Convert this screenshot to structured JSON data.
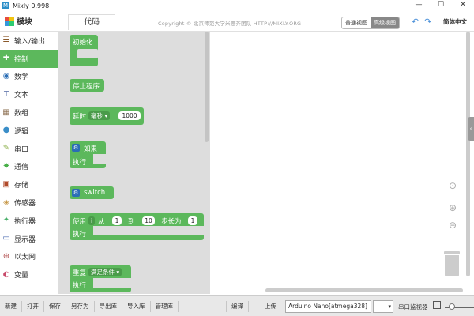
{
  "window": {
    "title": "Mixly 0.998",
    "app_icon_text": "M",
    "minimize": "—",
    "maximize": "☐",
    "close": "✕"
  },
  "header": {
    "blocks_title": "模块",
    "code_tab": "代码",
    "copyright": "Copyright © 北京师范大学米思齐团队 HTTP://MIXLY.ORG",
    "view_normal": "普通视图",
    "view_advanced": "高级视图",
    "undo": "↶",
    "redo": "↷",
    "language": "简体中文"
  },
  "sidebar": {
    "items": [
      {
        "label": "输入/输出",
        "icon": "io-icon",
        "glyph": "☰",
        "color": "#8b5a2b"
      },
      {
        "label": "控制",
        "icon": "gamepad-icon",
        "glyph": "✚",
        "color": "#ffffff",
        "selected": true
      },
      {
        "label": "数学",
        "icon": "math-icon",
        "glyph": "◉",
        "color": "#2a6db5"
      },
      {
        "label": "文本",
        "icon": "text-icon",
        "glyph": "T",
        "color": "#6a7db0"
      },
      {
        "label": "数组",
        "icon": "array-icon",
        "glyph": "▦",
        "color": "#8a6c4d"
      },
      {
        "label": "逻辑",
        "icon": "logic-icon",
        "glyph": "●",
        "color": "#3a8ec8"
      },
      {
        "label": "串口",
        "icon": "serial-icon",
        "glyph": "✎",
        "color": "#8cb04a"
      },
      {
        "label": "通信",
        "icon": "comm-icon",
        "glyph": "✸",
        "color": "#4ab04a"
      },
      {
        "label": "存储",
        "icon": "storage-icon",
        "glyph": "▣",
        "color": "#b04a2a"
      },
      {
        "label": "传感器",
        "icon": "sensor-icon",
        "glyph": "◈",
        "color": "#c89a4a"
      },
      {
        "label": "执行器",
        "icon": "actuator-icon",
        "glyph": "✦",
        "color": "#4ab06a"
      },
      {
        "label": "显示器",
        "icon": "display-icon",
        "glyph": "▭",
        "color": "#4a6ab0"
      },
      {
        "label": "以太网",
        "icon": "ethernet-icon",
        "glyph": "⊕",
        "color": "#b04a4a"
      },
      {
        "label": "变量",
        "icon": "variable-icon",
        "glyph": "◐",
        "color": "#c84a6a"
      }
    ]
  },
  "flyout": {
    "init": "初始化",
    "stop": "停止程序",
    "delay": {
      "label": "延时",
      "unit": "毫秒",
      "value": "1000"
    },
    "if_block": {
      "label": "如果",
      "do": "执行"
    },
    "switch_label": "switch",
    "for_block": {
      "use": "使用",
      "var": "i",
      "from": "从",
      "from_val": "1",
      "to": "到",
      "to_val": "10",
      "step": "步长为",
      "step_val": "1",
      "do": "执行"
    },
    "repeat_block": {
      "label": "重复",
      "cond": "满足条件",
      "do": "执行"
    }
  },
  "bottom": {
    "new": "新建",
    "open": "打开",
    "save": "保存",
    "save_as": "另存为",
    "export_lib": "导出库",
    "import_lib": "导入库",
    "manage_lib": "管理库",
    "compile": "编译",
    "upload": "上传",
    "board": "Arduino Nano[atmega328]",
    "port_arrow": "▾",
    "monitor": "串口监视器"
  },
  "colors": {
    "control_green": "#5cb85c",
    "gear_blue": "#2a6db5"
  }
}
